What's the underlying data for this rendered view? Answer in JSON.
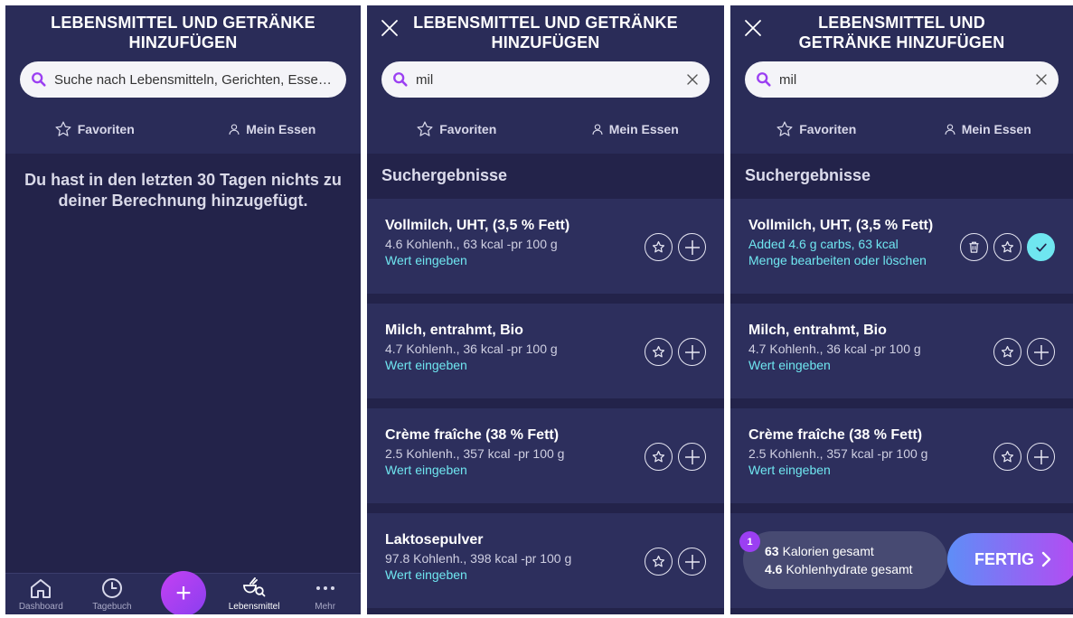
{
  "screens": [
    {
      "title": "LEBENSMITTEL UND GETRÄNKE HINZUFÜGEN",
      "search": "Suche nach Lebensmitteln, Gerichten, Essen,...",
      "tabs": {
        "favorites": "Favoriten",
        "my_food": "Mein Essen"
      },
      "empty_message": "Du hast in den letzten 30 Tagen nichts zu deiner Berechnung hinzugefügt.",
      "nav": {
        "dashboard": "Dashboard",
        "diary": "Tagebuch",
        "add": "+",
        "food": "Lebensmittel",
        "more": "Mehr"
      }
    },
    {
      "title": "LEBENSMITTEL UND GETRÄNKE HINZUFÜGEN",
      "search": "mil",
      "tabs": {
        "favorites": "Favoriten",
        "my_food": "Mein Essen"
      },
      "section": "Suchergebnisse",
      "results": [
        {
          "name": "Vollmilch, UHT, (3,5 % Fett)",
          "info": "4.6 Kohlenh., 63 kcal -pr 100 g",
          "link": "Wert eingeben"
        },
        {
          "name": "Milch, entrahmt, Bio",
          "info": "4.7 Kohlenh., 36 kcal -pr 100 g",
          "link": "Wert eingeben"
        },
        {
          "name": "Crème fraîche (38 % Fett)",
          "info": "2.5 Kohlenh., 357 kcal -pr 100 g",
          "link": "Wert eingeben"
        },
        {
          "name": "Laktosepulver",
          "info": "97.8 Kohlenh., 398 kcal -pr 100 g",
          "link": "Wert eingeben"
        }
      ]
    },
    {
      "title": "LEBENSMITTEL UND GETRÄNKE HINZUFÜGEN",
      "search": "mil",
      "tabs": {
        "favorites": "Favoriten",
        "my_food": "Mein Essen"
      },
      "section": "Suchergebnisse",
      "results": [
        {
          "name": "Vollmilch, UHT, (3,5 % Fett)",
          "info": "Added 4.6 g carbs, 63 kcal",
          "link": "Menge bearbeiten oder löschen",
          "added": true
        },
        {
          "name": "Milch, entrahmt, Bio",
          "info": "4.7 Kohlenh., 36 kcal -pr 100 g",
          "link": "Wert eingeben"
        },
        {
          "name": "Crème fraîche (38 % Fett)",
          "info": "2.5 Kohlenh., 357 kcal -pr 100 g",
          "link": "Wert eingeben"
        }
      ],
      "summary": {
        "badge": "1",
        "calories_value": "63",
        "calories_label": "Kalorien gesamt",
        "carbs_value": "4.6",
        "carbs_label": "Kohlenhydrate gesamt"
      },
      "done_label": "FERTIG"
    }
  ],
  "colors": {
    "background": "#23234a",
    "header": "#2a2c58",
    "card": "#2d2f5d",
    "accent_cyan": "#6fe6f0",
    "accent_purple": "#9b3ff2"
  }
}
